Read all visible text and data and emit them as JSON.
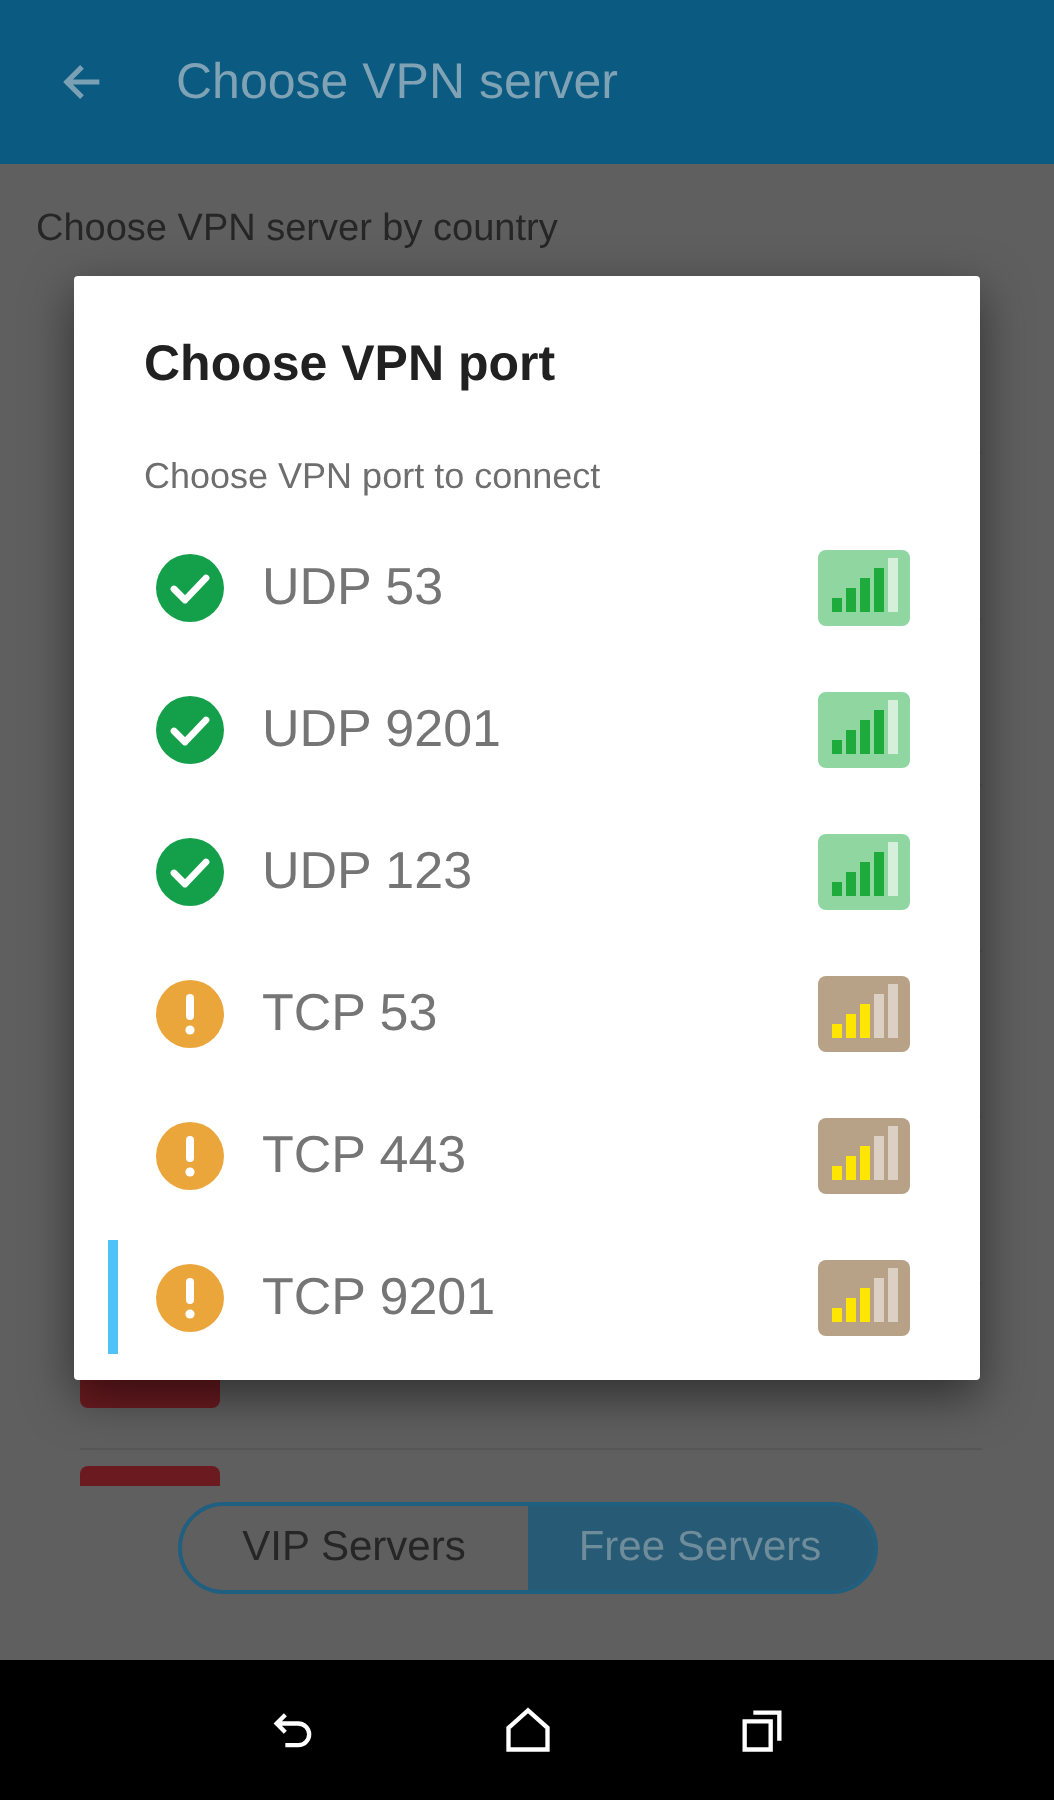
{
  "app_bar": {
    "title": "Choose VPN server"
  },
  "subtitle": "Choose VPN server by country",
  "dialog": {
    "title": "Choose VPN port",
    "message": "Choose VPN port to connect",
    "ports": [
      {
        "label": "UDP 53",
        "kind": "ok",
        "selected": false
      },
      {
        "label": "UDP 9201",
        "kind": "ok",
        "selected": false
      },
      {
        "label": "UDP 123",
        "kind": "ok",
        "selected": false
      },
      {
        "label": "TCP 53",
        "kind": "warn",
        "selected": false
      },
      {
        "label": "TCP 443",
        "kind": "warn",
        "selected": false
      },
      {
        "label": "TCP 9201",
        "kind": "warn",
        "selected": true
      }
    ]
  },
  "server_tabs": [
    {
      "label": "VIP Servers",
      "selected": false
    },
    {
      "label": "Free Servers",
      "selected": true
    }
  ]
}
